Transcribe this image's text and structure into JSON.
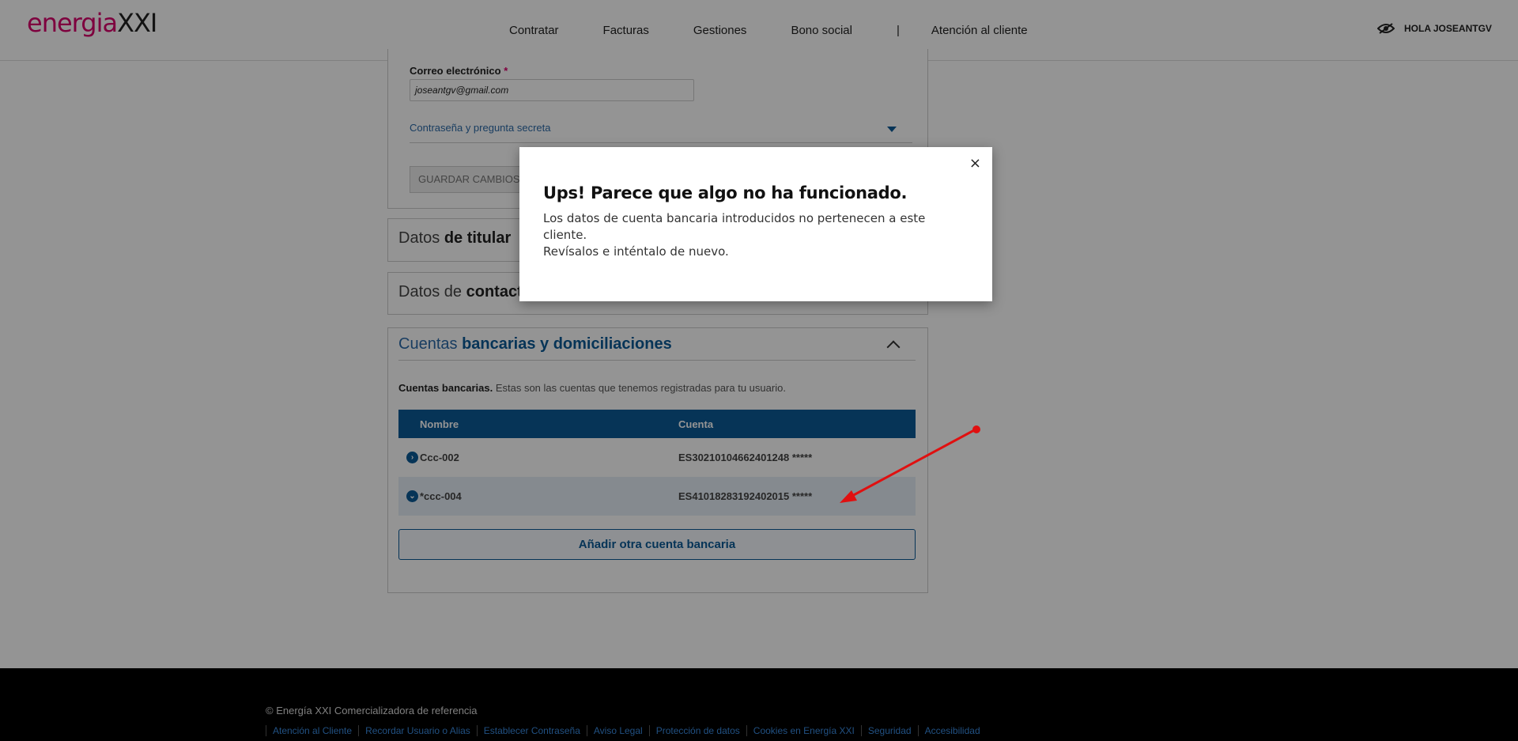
{
  "header": {
    "logo_part1": "energia",
    "logo_part2": "XXI",
    "nav": [
      "Contratar",
      "Facturas",
      "Gestiones",
      "Bono social",
      "|",
      "Atención al cliente"
    ],
    "user_greeting": "HOLA JOSEANTGV"
  },
  "account_form": {
    "email_label": "Correo electrónico",
    "required_mark": "*",
    "email_value": "joseantgv@gmail.com",
    "password_section": "Contraseña y pregunta secreta",
    "save_button": "GUARDAR CAMBIOS"
  },
  "sections": {
    "titular_light": "Datos ",
    "titular_bold": "de titular",
    "contacto_light": "Datos de ",
    "contacto_bold": "contacto",
    "bank_light": "Cuentas ",
    "bank_bold": "bancarias y domiciliaciones"
  },
  "bank": {
    "desc_bold": "Cuentas bancarias.",
    "desc_text": " Estas son las cuentas que tenemos registradas para tu usuario.",
    "columns": [
      "Nombre",
      "Cuenta"
    ],
    "rows": [
      {
        "name": "Ccc-002",
        "account": "ES30210104662401248 *****",
        "icon": "chevron-right-icon"
      },
      {
        "name": "*ccc-004",
        "account": "ES41018283192402015 *****",
        "icon": "chevron-down-icon"
      }
    ],
    "add_button": "Añadir otra cuenta bancaria"
  },
  "modal": {
    "close": "×",
    "title": "Ups! Parece que algo no ha funcionado.",
    "message_line1": "Los datos de cuenta bancaria introducidos no pertenecen a este cliente.",
    "message_line2": "Revísalos e inténtalo de nuevo."
  },
  "footer": {
    "copyright": "© Energía XXI Comercializadora de referencia",
    "links": [
      "Atención al Cliente",
      "Recordar Usuario o Alias",
      "Establecer Contraseña",
      "Aviso Legal",
      "Protección de datos",
      "Cookies en Energía XXI",
      "Seguridad",
      "Accesibilidad"
    ]
  },
  "colors": {
    "brand_pink": "#d9006c",
    "brand_blue": "#0b5a97",
    "annotation_arrow": "#e01010"
  }
}
